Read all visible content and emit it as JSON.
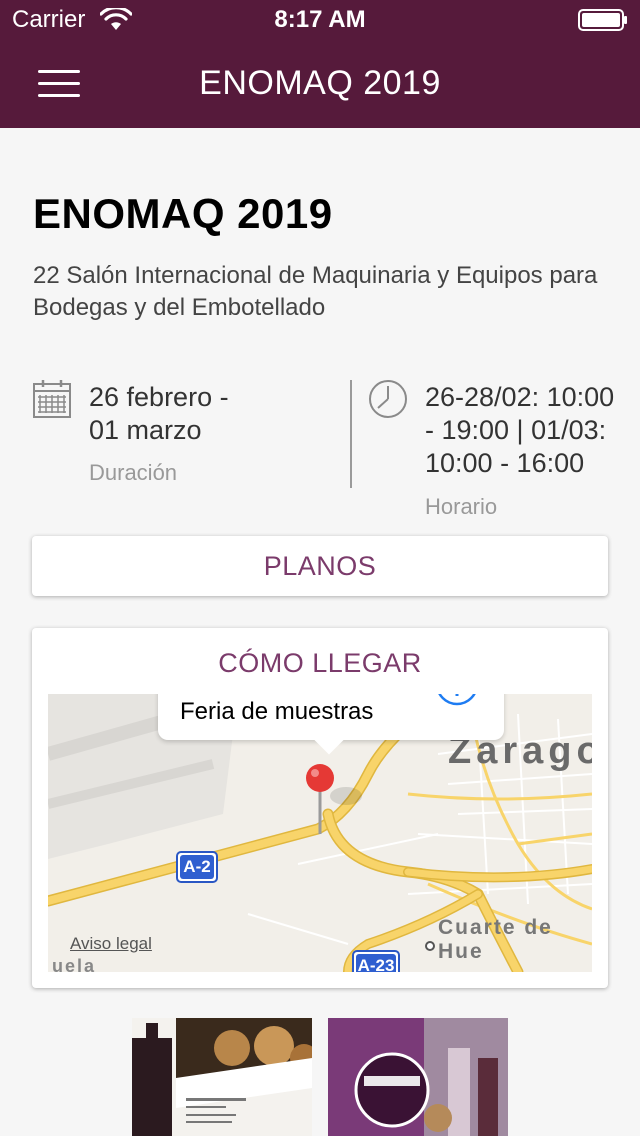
{
  "status_bar": {
    "carrier": "Carrier",
    "time": "8:17 AM"
  },
  "nav": {
    "title": "ENOMAQ 2019"
  },
  "event": {
    "title": "ENOMAQ 2019",
    "subtitle": "22 Salón Internacional de Maquinaria y Equipos para Bodegas y del Embotellado"
  },
  "duration": {
    "line1": "26 febrero -",
    "line2": "01 marzo",
    "label": "Duración"
  },
  "schedule": {
    "line1": "26-28/02: 10:00",
    "line2": "- 19:00 | 01/03:",
    "line3": "10:00 - 16:00",
    "label": "Horario"
  },
  "buttons": {
    "planos": "PLANOS"
  },
  "directions": {
    "title": "CÓMO LLEGAR",
    "map": {
      "callout": "Feria de muestras",
      "city_label": "Zaragoz",
      "town_label": "Cuarte de Hue",
      "partial_label": "uela",
      "road_a2": "A-2",
      "road_a23": "A-23",
      "legal_link": "Aviso legal"
    }
  },
  "colors": {
    "header": "#561a3b",
    "accent": "#7b3b6b"
  }
}
